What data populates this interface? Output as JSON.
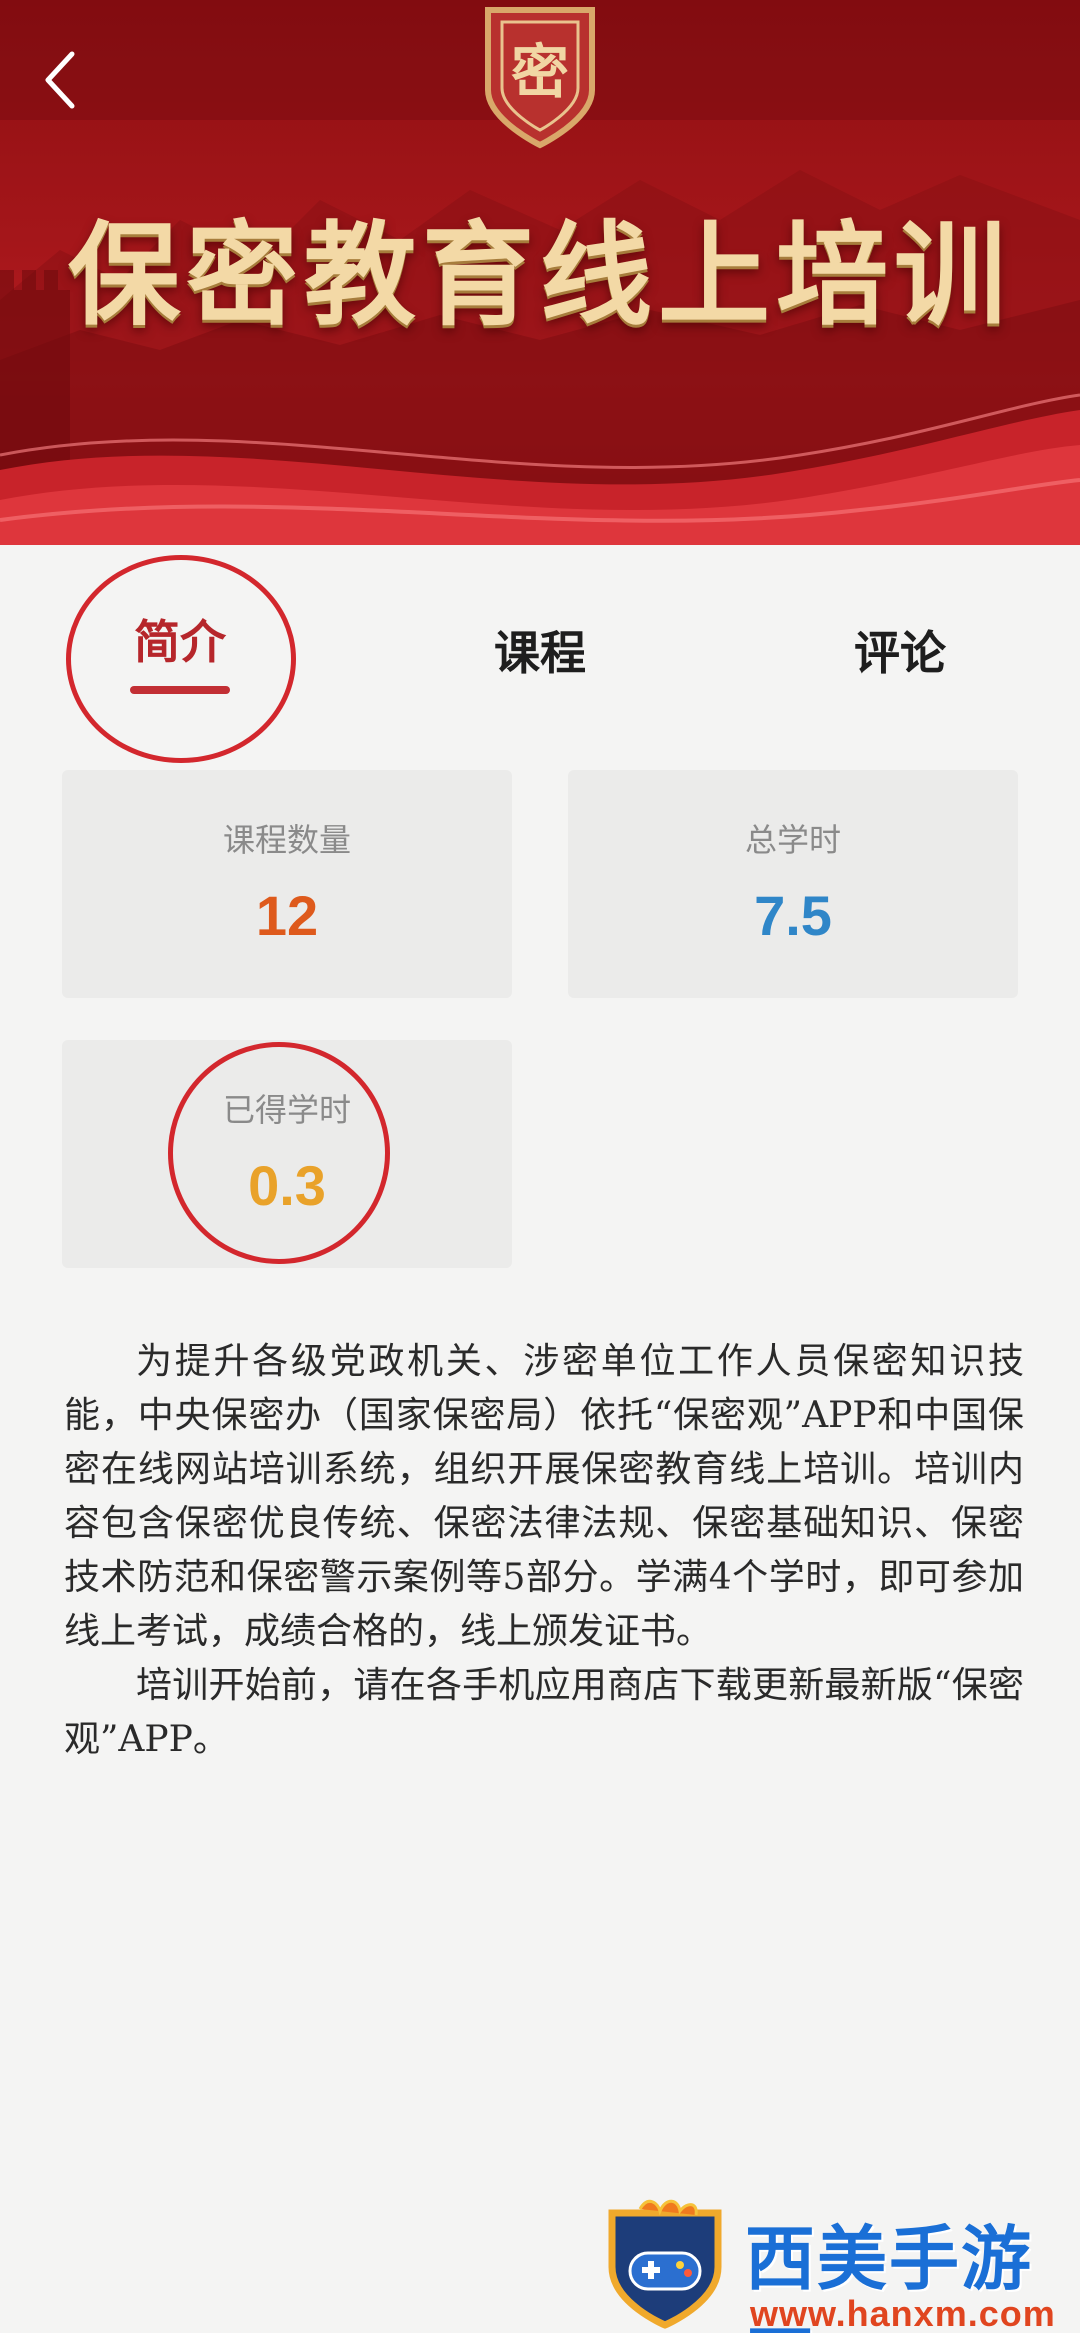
{
  "banner": {
    "title": "保密教育线上培训",
    "emblem_label": "密"
  },
  "tabs": [
    {
      "label": "简介",
      "active": true
    },
    {
      "label": "课程",
      "active": false
    },
    {
      "label": "评论",
      "active": false
    }
  ],
  "stats": {
    "course_count_label": "课程数量",
    "course_count_value": "12",
    "total_hours_label": "总学时",
    "total_hours_value": "7.5",
    "earned_hours_label": "已得学时",
    "earned_hours_value": "0.3"
  },
  "description": {
    "paragraph1": "为提升各级党政机关、涉密单位工作人员保密知识技能，中央保密办（国家保密局）依托“保密观”APP和中国保密在线网站培训系统，组织开展保密教育线上培训。培训内容包含保密优良传统、保密法律法规、保密基础知识、保密技术防范和保密警示案例等5部分。学满4个学时，即可参加线上考试，成绩合格的，线上颁发证书。",
    "paragraph2": "培训开始前，请在各手机应用商店下载更新最新版“保密观”APP。"
  },
  "watermark": {
    "name": "西美手游网",
    "url": "www.hanxm.com"
  },
  "colors": {
    "banner_red": "#a5161a",
    "title_gold": "#f3d9a6",
    "accent_red": "#c22f34",
    "course_count": "#de5a1c",
    "total_hours": "#2f86c8",
    "earned_hours": "#e9a22a"
  },
  "icons": {
    "back": "chevron-left-icon",
    "emblem": "shield-emblem-icon",
    "watermark_logo": "gamepad-shield-icon"
  }
}
